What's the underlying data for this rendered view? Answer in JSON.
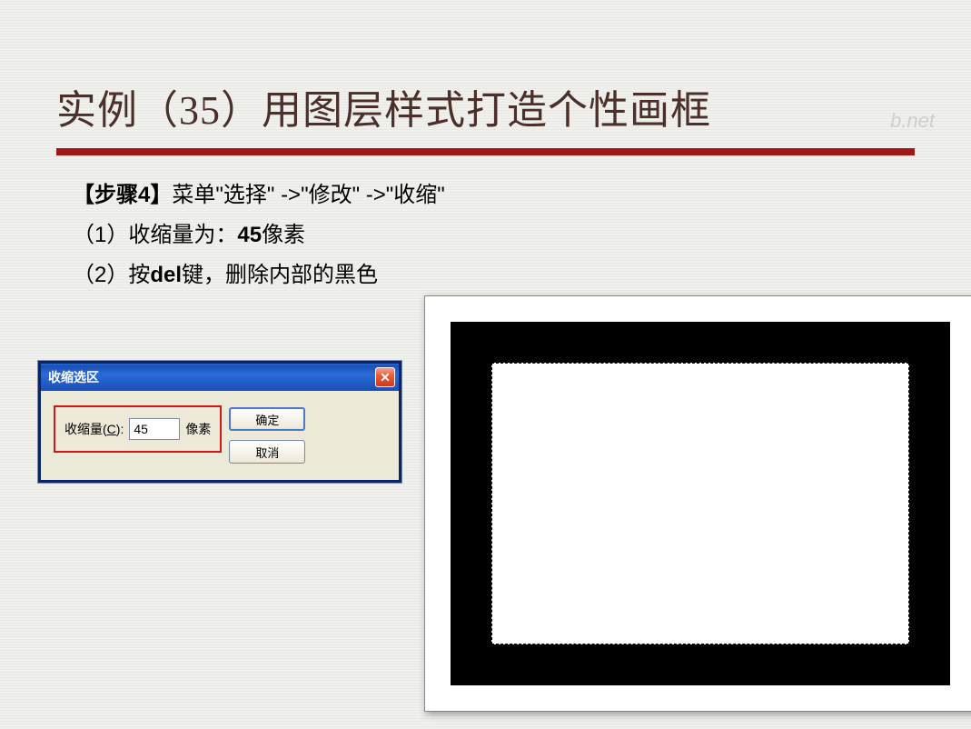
{
  "title": "实例（35）用图层样式打造个性画框",
  "steps": {
    "line1_prefix": "【步骤4】",
    "line1_rest": "菜单\"选择\" ->\"修改\" ->\"收缩\"",
    "line2_prefix": "（1）收缩量为：",
    "line2_bold": "45",
    "line2_suffix": "像素",
    "line3_prefix": "（2）按",
    "line3_bold": "del",
    "line3_suffix": "键，删除内部的黑色"
  },
  "dialog": {
    "title": "收缩选区",
    "close": "✕",
    "field_label_pre": "收缩量(",
    "field_label_key": "C",
    "field_label_post": "):",
    "value": "45",
    "unit": "像素",
    "ok": "确定",
    "cancel": "取消"
  },
  "watermark": "b.net"
}
